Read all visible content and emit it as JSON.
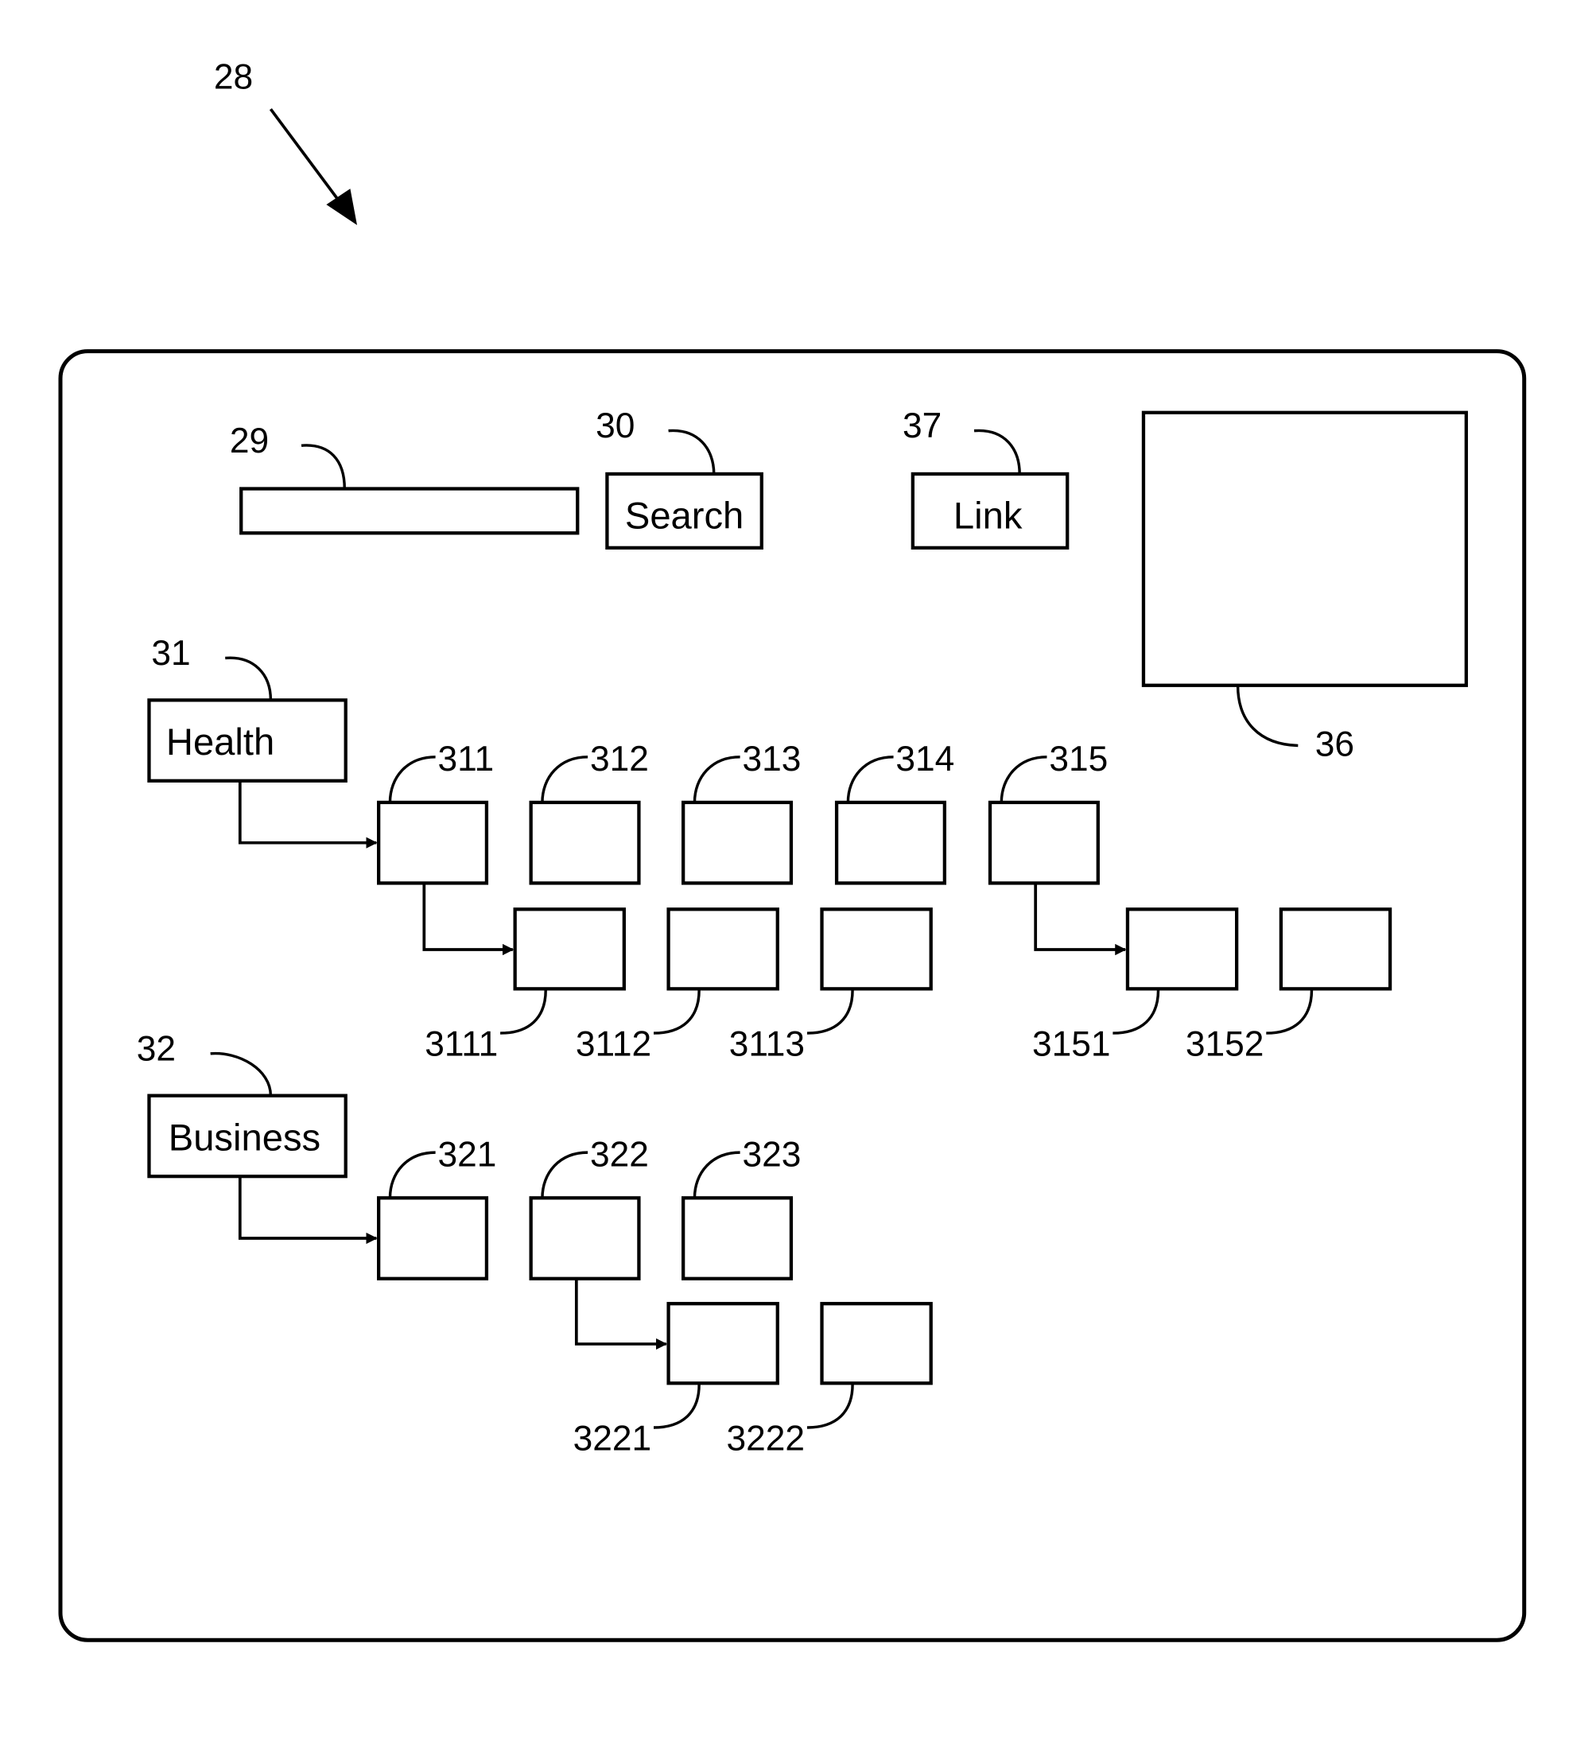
{
  "figure": {
    "reference": "28"
  },
  "header": {
    "search_field": {
      "reference": "29",
      "value": "",
      "placeholder": ""
    },
    "search_button": {
      "reference": "30",
      "label": "Search"
    },
    "link_button": {
      "reference": "37",
      "label": "Link"
    },
    "display_panel": {
      "reference": "36"
    }
  },
  "categories": [
    {
      "reference": "31",
      "label": "Health",
      "items": [
        {
          "reference": "311",
          "subitems": [
            {
              "reference": "3111"
            },
            {
              "reference": "3112"
            },
            {
              "reference": "3113"
            }
          ]
        },
        {
          "reference": "312",
          "subitems": []
        },
        {
          "reference": "313",
          "subitems": []
        },
        {
          "reference": "314",
          "subitems": []
        },
        {
          "reference": "315",
          "subitems": [
            {
              "reference": "3151"
            },
            {
              "reference": "3152"
            }
          ]
        }
      ]
    },
    {
      "reference": "32",
      "label": "Business",
      "items": [
        {
          "reference": "321",
          "subitems": []
        },
        {
          "reference": "322",
          "subitems": [
            {
              "reference": "3221"
            },
            {
              "reference": "3222"
            }
          ]
        },
        {
          "reference": "323",
          "subitems": []
        }
      ]
    }
  ]
}
